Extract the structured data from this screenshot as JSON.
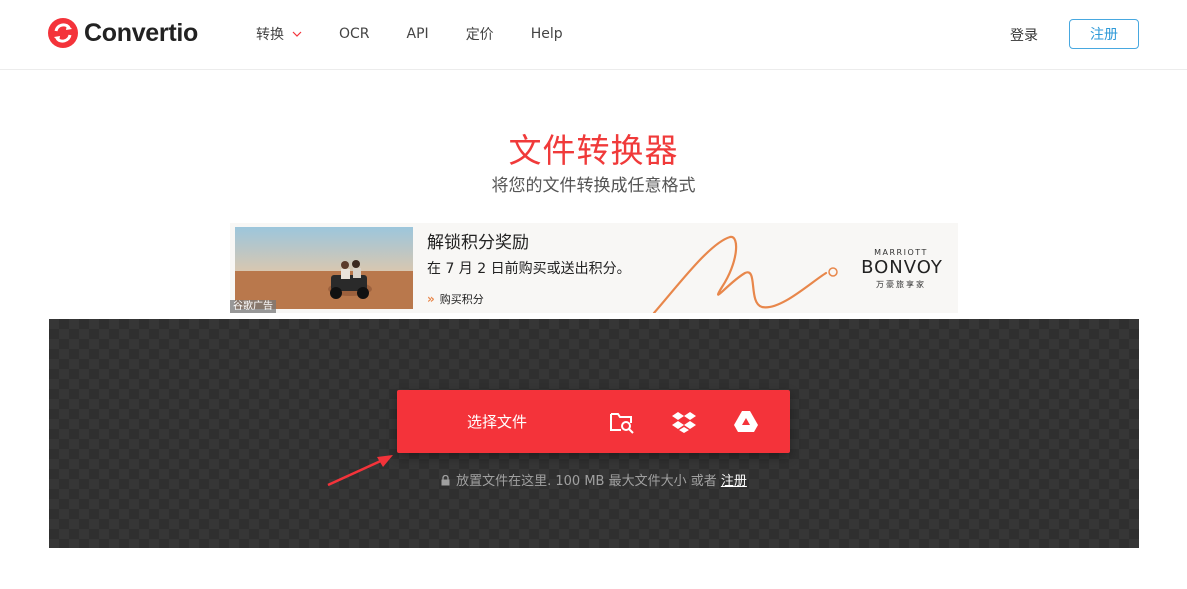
{
  "header": {
    "brand": "Convertio",
    "nav": [
      {
        "label": "转换",
        "has_dropdown": true
      },
      {
        "label": "OCR"
      },
      {
        "label": "API"
      },
      {
        "label": "定价"
      },
      {
        "label": "Help"
      }
    ],
    "login_label": "登录",
    "signup_label": "注册"
  },
  "hero": {
    "title": "文件转换器",
    "subtitle": "将您的文件转换成任意格式"
  },
  "ad": {
    "headline": "解锁积分奖励",
    "body": "在 7 月 2 日前购买或送出积分。",
    "cta": "购买积分",
    "brand_top": "MARRIOTT",
    "brand_main": "BONVOY",
    "brand_sub": "万豪旅享家",
    "tag": "谷歌广告"
  },
  "upload": {
    "choose_label": "选择文件",
    "sources": [
      "folder-search-icon",
      "dropbox-icon",
      "google-drive-icon"
    ],
    "note_text": "放置文件在这里. 100 MB 最大文件大小 或者 ",
    "note_link": "注册"
  },
  "colors": {
    "brand_red": "#f4333a",
    "title_red": "#f03a3a",
    "signup_blue": "#2f9ad8",
    "dropzone_bg": "#363636",
    "ad_accent": "#e8874b"
  }
}
